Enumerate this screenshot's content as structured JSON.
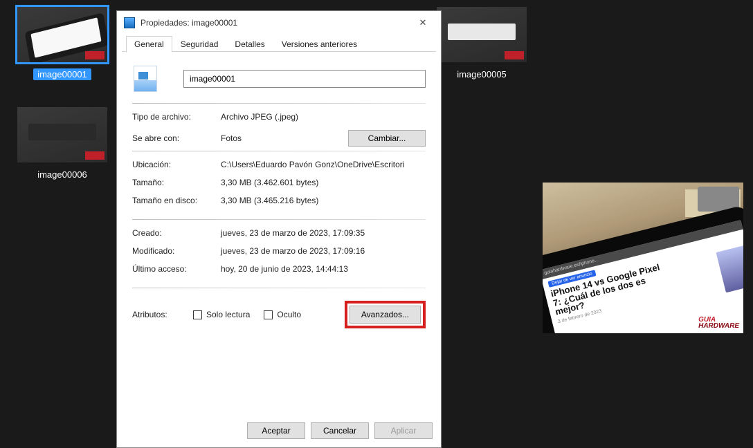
{
  "desktop": {
    "thumbs": [
      {
        "label": "image00001",
        "type": "phone",
        "selected": true
      },
      {
        "label": "image00005",
        "type": "box-white",
        "selected": false
      },
      {
        "label": "image00006",
        "type": "box-black",
        "selected": false
      }
    ]
  },
  "dialog": {
    "title": "Propiedades: image00001",
    "tabs": {
      "general": "General",
      "security": "Seguridad",
      "details": "Detalles",
      "previous": "Versiones anteriores"
    },
    "filename": "image00001",
    "filetype": {
      "label": "Tipo de archivo:",
      "value": "Archivo JPEG (.jpeg)"
    },
    "openswith": {
      "label": "Se abre con:",
      "value": "Fotos",
      "change_btn": "Cambiar..."
    },
    "location": {
      "label": "Ubicación:",
      "value": "C:\\Users\\Eduardo Pavón Gonz\\OneDrive\\Escritori"
    },
    "size": {
      "label": "Tamaño:",
      "value": "3,30 MB (3.462.601 bytes)"
    },
    "sizedisk": {
      "label": "Tamaño en disco:",
      "value": "3,30 MB (3.465.216 bytes)"
    },
    "created": {
      "label": "Creado:",
      "value": "jueves, 23 de marzo de 2023, 17:09:35"
    },
    "modified": {
      "label": "Modificado:",
      "value": "jueves, 23 de marzo de 2023, 17:09:16"
    },
    "accessed": {
      "label": "Último acceso:",
      "value": "hoy, 20 de junio de 2023, 14:44:13"
    },
    "attributes": {
      "label": "Atributos:",
      "readonly": "Solo lectura",
      "hidden": "Oculto",
      "advanced": "Avanzados..."
    },
    "buttons": {
      "ok": "Aceptar",
      "cancel": "Cancelar",
      "apply": "Aplicar"
    }
  },
  "preview": {
    "badge": "Dejar de ver anuncio",
    "addr": "guiahardware.es/iphone...",
    "headline": "iPhone 14 vs Google Pixel 7: ¿Cuál de los dos es mejor?",
    "sub": "3 de febrero de 2023",
    "logo1": "GUIA",
    "logo2": "HARDWARE"
  }
}
